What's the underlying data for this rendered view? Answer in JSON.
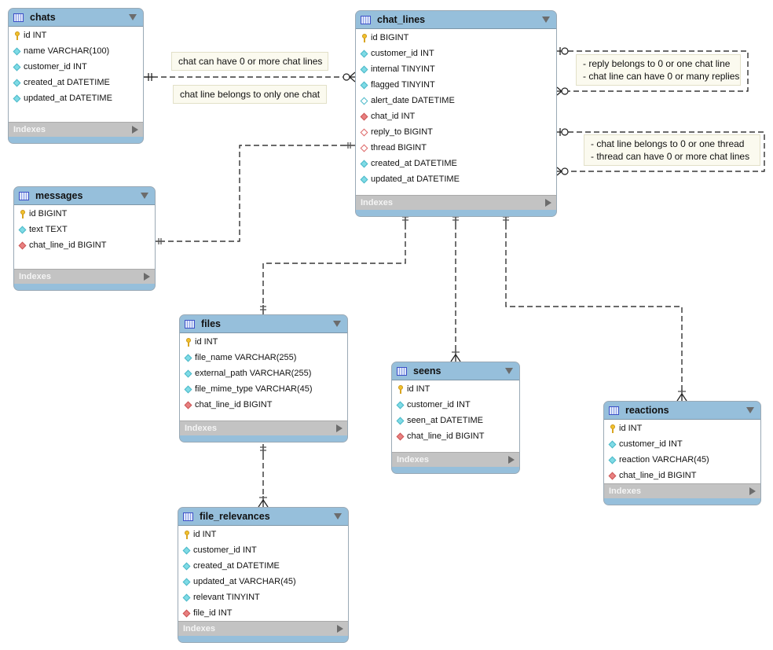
{
  "diagram": {
    "type": "EER diagram",
    "indexes_label": "Indexes",
    "tables": [
      {
        "id": "chats",
        "name": "chats",
        "columns": [
          {
            "name": "id INT",
            "kind": "pk"
          },
          {
            "name": "name VARCHAR(100)",
            "kind": "attr"
          },
          {
            "name": "customer_id INT",
            "kind": "attr"
          },
          {
            "name": "created_at DATETIME",
            "kind": "attr"
          },
          {
            "name": "updated_at DATETIME",
            "kind": "attr"
          }
        ]
      },
      {
        "id": "chat_lines",
        "name": "chat_lines",
        "columns": [
          {
            "name": "id BIGINT",
            "kind": "pk"
          },
          {
            "name": "customer_id INT",
            "kind": "attr"
          },
          {
            "name": "internal TINYINT",
            "kind": "attr"
          },
          {
            "name": "flagged TINYINT",
            "kind": "attr"
          },
          {
            "name": "alert_date DATETIME",
            "kind": "attr-nullable"
          },
          {
            "name": "chat_id INT",
            "kind": "fk"
          },
          {
            "name": "reply_to BIGINT",
            "kind": "fk-nullable"
          },
          {
            "name": "thread BIGINT",
            "kind": "fk-nullable"
          },
          {
            "name": "created_at DATETIME",
            "kind": "attr"
          },
          {
            "name": "updated_at DATETIME",
            "kind": "attr"
          }
        ]
      },
      {
        "id": "messages",
        "name": "messages",
        "columns": [
          {
            "name": "id BIGINT",
            "kind": "pk"
          },
          {
            "name": "text TEXT",
            "kind": "attr"
          },
          {
            "name": "chat_line_id BIGINT",
            "kind": "fk"
          }
        ]
      },
      {
        "id": "files",
        "name": "files",
        "columns": [
          {
            "name": "id INT",
            "kind": "pk"
          },
          {
            "name": "file_name VARCHAR(255)",
            "kind": "attr"
          },
          {
            "name": "external_path VARCHAR(255)",
            "kind": "attr"
          },
          {
            "name": "file_mime_type VARCHAR(45)",
            "kind": "attr"
          },
          {
            "name": "chat_line_id BIGINT",
            "kind": "fk"
          }
        ]
      },
      {
        "id": "seens",
        "name": "seens",
        "columns": [
          {
            "name": "id INT",
            "kind": "pk"
          },
          {
            "name": "customer_id INT",
            "kind": "attr"
          },
          {
            "name": "seen_at DATETIME",
            "kind": "attr"
          },
          {
            "name": "chat_line_id BIGINT",
            "kind": "fk"
          }
        ]
      },
      {
        "id": "reactions",
        "name": "reactions",
        "columns": [
          {
            "name": "id INT",
            "kind": "pk"
          },
          {
            "name": "customer_id INT",
            "kind": "attr"
          },
          {
            "name": "reaction VARCHAR(45)",
            "kind": "attr"
          },
          {
            "name": "chat_line_id BIGINT",
            "kind": "fk"
          }
        ]
      },
      {
        "id": "file_relevances",
        "name": "file_relevances",
        "columns": [
          {
            "name": "id INT",
            "kind": "pk"
          },
          {
            "name": "customer_id INT",
            "kind": "attr"
          },
          {
            "name": "created_at DATETIME",
            "kind": "attr"
          },
          {
            "name": "updated_at VARCHAR(45)",
            "kind": "attr"
          },
          {
            "name": "relevant TINYINT",
            "kind": "attr"
          },
          {
            "name": "file_id INT",
            "kind": "fk"
          }
        ]
      }
    ],
    "notes": [
      {
        "id": "note-chat-many-lines",
        "lines": [
          "chat can have 0 or more chat lines"
        ]
      },
      {
        "id": "note-line-one-chat",
        "lines": [
          "chat line belongs to only one chat"
        ]
      },
      {
        "id": "note-reply",
        "lines": [
          "- reply belongs to 0 or one chat line",
          "- chat line can have 0 or many replies"
        ]
      },
      {
        "id": "note-thread",
        "lines": [
          "- chat line belongs to 0 or one thread",
          "- thread can have 0 or more chat lines"
        ]
      }
    ],
    "relationships": [
      {
        "from": "chats",
        "to": "chat_lines",
        "from_card": "one-and-only-one",
        "to_card": "zero-or-many"
      },
      {
        "from": "chat_lines",
        "to": "chat_lines",
        "label": "reply_to",
        "from_card": "zero-or-one",
        "to_card": "zero-or-many"
      },
      {
        "from": "chat_lines",
        "to": "chat_lines",
        "label": "thread",
        "from_card": "zero-or-one",
        "to_card": "zero-or-many"
      },
      {
        "from": "chat_lines",
        "to": "messages",
        "from_card": "one-and-only-one",
        "to_card": "one-and-only-one"
      },
      {
        "from": "chat_lines",
        "to": "files",
        "from_card": "one-and-only-one",
        "to_card": "one-and-only-one"
      },
      {
        "from": "chat_lines",
        "to": "seens",
        "from_card": "one-and-only-one",
        "to_card": "one-or-many"
      },
      {
        "from": "chat_lines",
        "to": "reactions",
        "from_card": "one-and-only-one",
        "to_card": "one-or-many"
      },
      {
        "from": "files",
        "to": "file_relevances",
        "from_card": "one-and-only-one",
        "to_card": "one-or-many"
      }
    ]
  }
}
